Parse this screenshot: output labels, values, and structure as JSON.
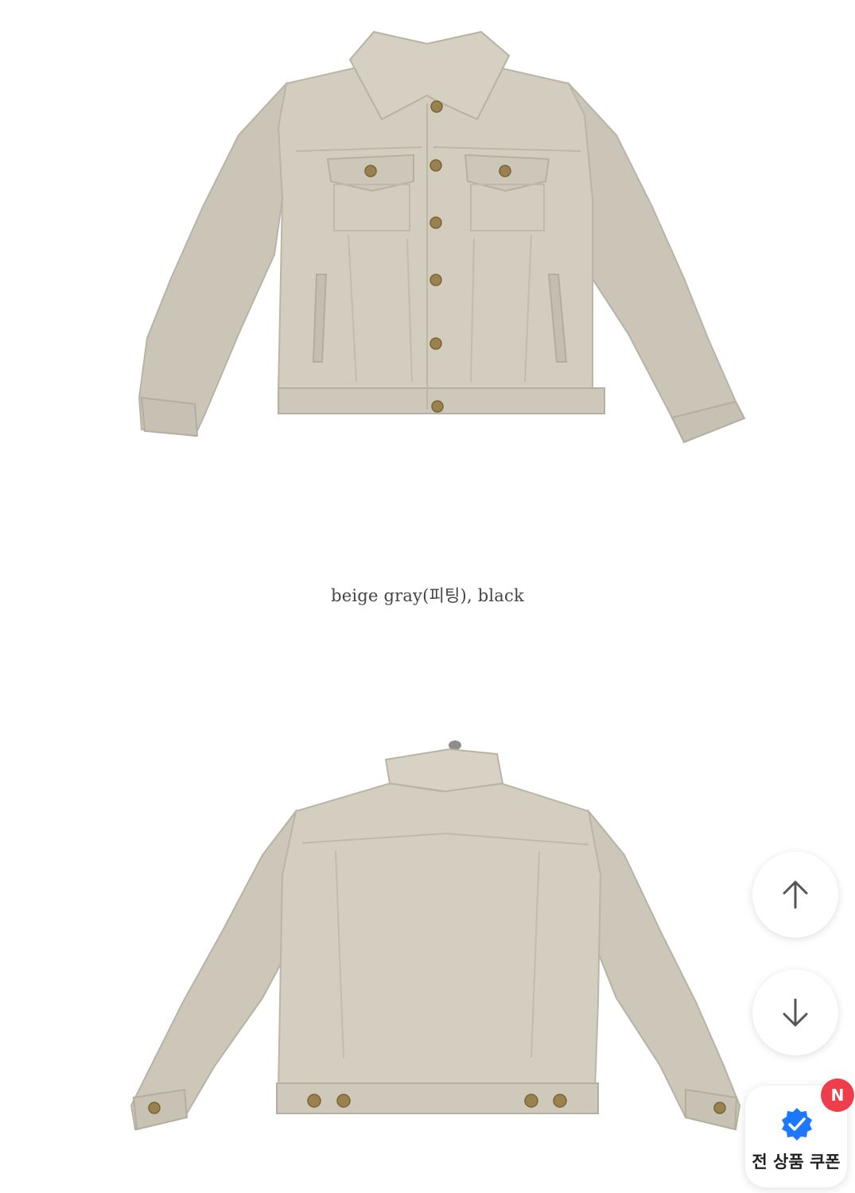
{
  "product": {
    "color_caption": "beige gray(피팅), black",
    "garment_color": "#cfc9bc",
    "button_color": "#9a8150"
  },
  "floating": {
    "scroll_up_icon": "arrow-up-icon",
    "scroll_down_icon": "arrow-down-icon",
    "coupon_icon": "verified-badge-icon",
    "coupon_label": "전 상품 쿠폰",
    "new_badge": "N",
    "coupon_accent": "#1e78ff",
    "badge_color": "#ef3d4c"
  }
}
